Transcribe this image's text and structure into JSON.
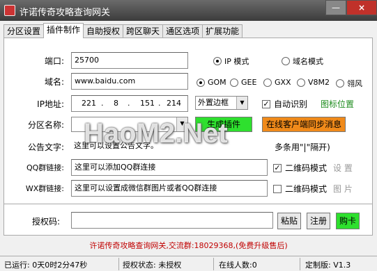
{
  "window": {
    "title": "许诺传奇攻略查询网关",
    "minimize": "—",
    "close": "×"
  },
  "tabs": [
    {
      "label": "分区设置"
    },
    {
      "label": "插件制作"
    },
    {
      "label": "自助授权"
    },
    {
      "label": "跨区聊天"
    },
    {
      "label": "通区选项"
    },
    {
      "label": "扩展功能"
    }
  ],
  "form": {
    "port_label": "端口:",
    "port_value": "25700",
    "mode_ip": "IP 模式",
    "mode_domain": "域名模式",
    "domain_label": "域名:",
    "domain_value": "www.baidu.com",
    "engines": [
      "GOM",
      "GEE",
      "GXX",
      "V8M2",
      "翎风"
    ],
    "ip_label": "IP地址:",
    "ip_parts": [
      "221",
      "8",
      "151",
      "214"
    ],
    "skin_select": "外置边框",
    "auto_detect": "自动识别",
    "icon_position": "图标位置",
    "zone_label": "分区名称:",
    "zone_value": "",
    "gen_button": "生成插件",
    "sync_button": "在线客户端同步消息",
    "notice_label": "公告文字:",
    "notice_value": "这里可以设置公告文字。",
    "notice_hint": "多条用\"|\"隔开)",
    "qq_label": "QQ群链接:",
    "qq_value": "这里可以添加QQ群连接",
    "qq_qrcode": "二维码模式",
    "qq_setting": "设 置",
    "wx_label": "WX群链接:",
    "wx_value": "这里可以设置成微信群图片或者QQ群连接",
    "wx_qrcode": "二维码模式",
    "wx_image": "图 片"
  },
  "auth": {
    "label": "授权码:",
    "value": "",
    "paste": "粘贴",
    "register": "注册",
    "buy": "购卡"
  },
  "footer": "许诺传奇攻略查询网关,交流群:18029368,(免费升级售后)",
  "status": {
    "uptime": "已运行: 0天0时2分47秒",
    "auth_state": "授权状态: 未授权",
    "online": "在线人数:0",
    "version": "定制版: V1.3"
  },
  "watermark": "HaoM2.Net",
  "colors": {
    "green_button": "#2ee02e",
    "orange_button": "#f08a1a",
    "footer_red": "#c00000"
  }
}
